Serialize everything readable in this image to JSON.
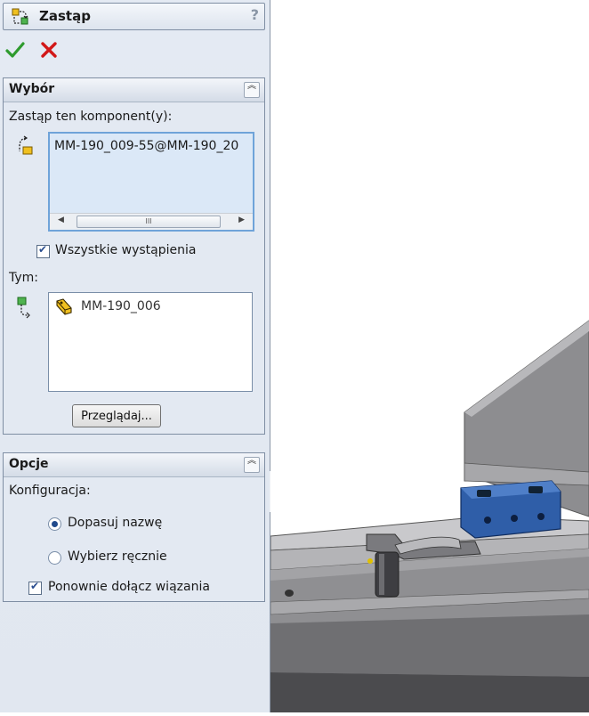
{
  "panel": {
    "title": "Zastąp",
    "help": "?"
  },
  "selection": {
    "header": "Wybór",
    "replace_label": "Zastąp ten komponent(y):",
    "source_items": [
      "MM-190_009-55@MM-190_20"
    ],
    "all_instances_label": "Wszystkie wystąpienia",
    "all_instances_checked": true,
    "with_label": "Tym:",
    "target_items": [
      "MM-190_006"
    ],
    "browse_label": "Przeglądaj...",
    "scroll_thumb": "III"
  },
  "options": {
    "header": "Opcje",
    "config_label": "Konfiguracja:",
    "radio_match_name": "Dopasuj nazwę",
    "radio_manual": "Wybierz ręcznie",
    "selected_radio": "match_name",
    "reattach_mates_label": "Ponownie dołącz wiązania",
    "reattach_mates_checked": true
  },
  "icons": [
    "replace-components-icon",
    "ok-check-icon",
    "cancel-x-icon",
    "collapse-chevron-icon",
    "component-source-icon",
    "component-target-icon",
    "part-icon"
  ],
  "colors": {
    "ok": "#2e9b2e",
    "cancel": "#d21818",
    "selection_highlight": "#dbe8f7",
    "part_blue": "#2f5ea8"
  }
}
